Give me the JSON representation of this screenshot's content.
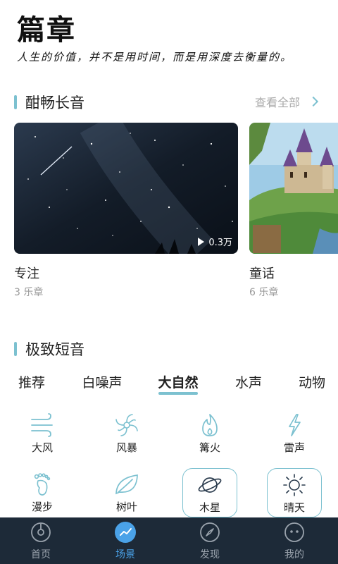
{
  "header": {
    "title": "篇章",
    "motto": "人生的价值，并不是用时间，而是用深度去衡量的。"
  },
  "long_section": {
    "title": "酣畅长音",
    "see_all": "查看全部",
    "cards": [
      {
        "title": "专注",
        "count": "3 乐章",
        "plays": "0.3万"
      },
      {
        "title": "童话",
        "count": "6 乐章"
      }
    ]
  },
  "short_section": {
    "title": "极致短音",
    "tabs": [
      "推荐",
      "白噪声",
      "大自然",
      "水声",
      "动物"
    ],
    "active_tab": "大自然",
    "sounds": [
      {
        "label": "大风",
        "icon": "wind-icon"
      },
      {
        "label": "风暴",
        "icon": "storm-icon"
      },
      {
        "label": "篝火",
        "icon": "fire-icon"
      },
      {
        "label": "雷声",
        "icon": "thunder-icon"
      },
      {
        "label": "漫步",
        "icon": "footprint-icon"
      },
      {
        "label": "树叶",
        "icon": "leaf-icon"
      },
      {
        "label": "木星",
        "icon": "planet-icon",
        "selected": true
      },
      {
        "label": "晴天",
        "icon": "sun-icon",
        "selected": true
      }
    ]
  },
  "bottom_nav": {
    "items": [
      {
        "label": "首页",
        "icon": "home-disc-icon"
      },
      {
        "label": "场景",
        "icon": "scene-chart-icon",
        "active": true
      },
      {
        "label": "发现",
        "icon": "compass-icon"
      },
      {
        "label": "我的",
        "icon": "profile-face-icon"
      }
    ]
  },
  "colors": {
    "accent": "#7cc1d0",
    "nav_bg": "#1d2a38",
    "nav_active": "#4aa2e8"
  }
}
